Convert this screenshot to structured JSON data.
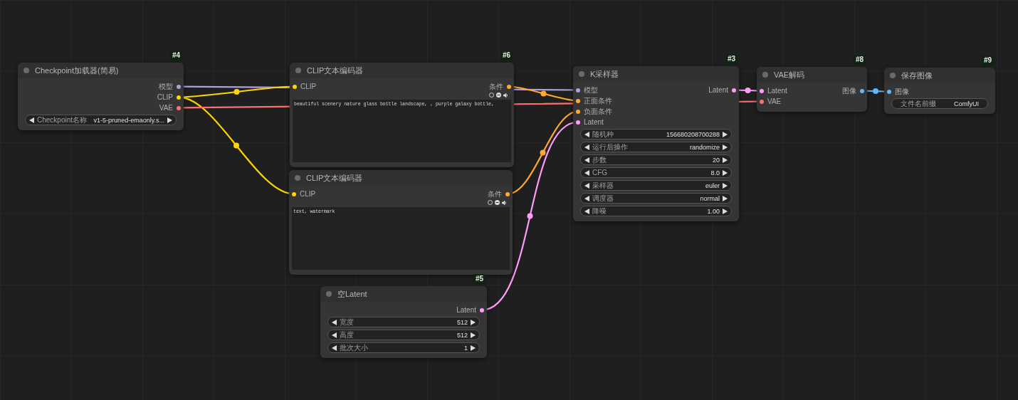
{
  "nodes": [
    {
      "badge": "#4",
      "title": "Checkpoint加载器(简易)",
      "outputs": [
        {
          "label": "模型",
          "color": "#b39ddb"
        },
        {
          "label": "CLIP",
          "color": "#ffd500"
        },
        {
          "label": "VAE",
          "color": "#ff6e6e"
        }
      ],
      "widgets": [
        {
          "kind": "combo",
          "label": "Checkpoint名称",
          "value": "v1-5-pruned-emaonly.s..."
        }
      ]
    },
    {
      "badge": "#6",
      "title": "CLIP文本编码器",
      "inputs": [
        {
          "label": "CLIP",
          "color": "#ffd500"
        }
      ],
      "outputs": [
        {
          "label": "条件",
          "color": "#ffa931"
        }
      ],
      "prompt": "beautiful scenery nature glass bottle landscape, , purple galaxy bottle,"
    },
    {
      "title": "CLIP文本编码器",
      "inputs": [
        {
          "label": "CLIP",
          "color": "#ffd500"
        }
      ],
      "outputs": [
        {
          "label": "条件",
          "color": "#ffa931"
        }
      ],
      "prompt": "text, watermark"
    },
    {
      "badge": "#5",
      "title": "空Latent",
      "outputs": [
        {
          "label": "Latent",
          "color": "#ff9cf9"
        }
      ],
      "widgets": [
        {
          "kind": "number",
          "label": "宽度",
          "value": "512"
        },
        {
          "kind": "number",
          "label": "高度",
          "value": "512"
        },
        {
          "kind": "number",
          "label": "批次大小",
          "value": "1"
        }
      ]
    },
    {
      "badge": "#3",
      "title": "K采样器",
      "inputs": [
        {
          "label": "模型",
          "color": "#b39ddb"
        },
        {
          "label": "正面条件",
          "color": "#ffa931"
        },
        {
          "label": "负面条件",
          "color": "#ffa931"
        },
        {
          "label": "Latent",
          "color": "#ff9cf9"
        }
      ],
      "outputs": [
        {
          "label": "Latent",
          "color": "#ff9cf9"
        }
      ],
      "widgets": [
        {
          "kind": "number",
          "label": "随机种",
          "value": "156680208700288"
        },
        {
          "kind": "combo",
          "label": "运行后操作",
          "value": "randomize"
        },
        {
          "kind": "number",
          "label": "步数",
          "value": "20"
        },
        {
          "kind": "number",
          "label": "CFG",
          "value": "8.0"
        },
        {
          "kind": "combo",
          "label": "采样器",
          "value": "euler"
        },
        {
          "kind": "combo",
          "label": "调度器",
          "value": "normal"
        },
        {
          "kind": "number",
          "label": "降噪",
          "value": "1.00"
        }
      ]
    },
    {
      "badge": "#8",
      "title": "VAE解码",
      "inputs": [
        {
          "label": "Latent",
          "color": "#ff9cf9"
        },
        {
          "label": "VAE",
          "color": "#ff6e6e"
        }
      ],
      "outputs": [
        {
          "label": "图像",
          "color": "#64b5f6"
        }
      ]
    },
    {
      "badge": "#9",
      "title": "保存图像",
      "inputs": [
        {
          "label": "图像",
          "color": "#64b5f6"
        }
      ],
      "widgets": [
        {
          "kind": "text",
          "label": "文件名前缀",
          "value": "ComfyUI"
        }
      ]
    }
  ]
}
